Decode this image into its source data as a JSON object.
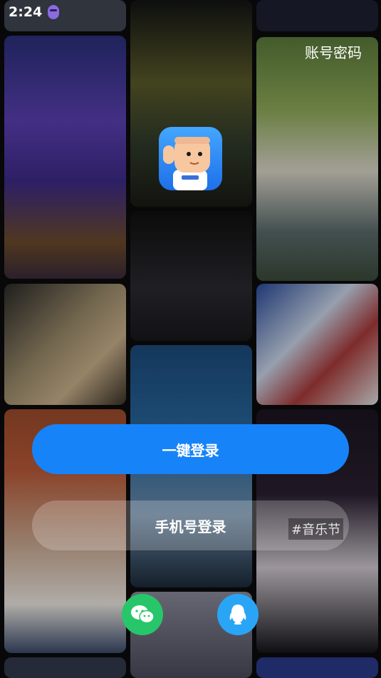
{
  "status_bar": {
    "time": "2:24"
  },
  "header": {
    "account_password_label": "账号密码"
  },
  "actions": {
    "one_click_login": "一键登录",
    "phone_login": "手机号登录"
  },
  "overlay_tag": "#音乐节",
  "icons": {
    "logo": "app-logo-icon",
    "wechat": "wechat-icon",
    "qq": "qq-icon",
    "status_app": "bug-icon"
  },
  "colors": {
    "primary_button": "#1783f8",
    "wechat": "#28c66a",
    "qq": "#2aa5f6"
  }
}
